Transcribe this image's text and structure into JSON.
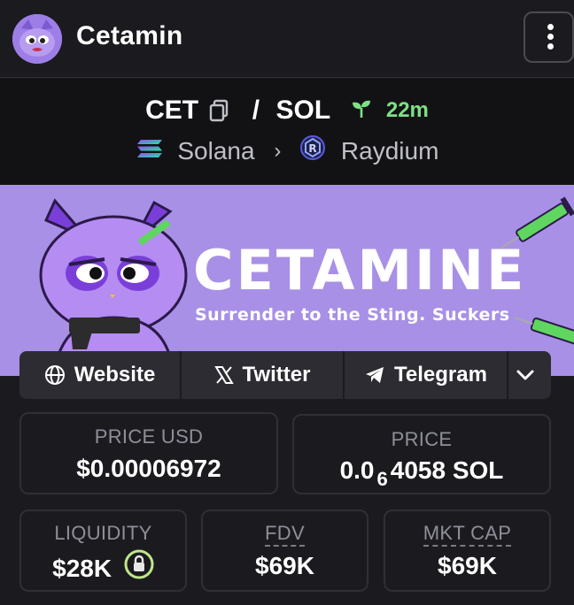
{
  "header": {
    "token_name": "Cetamin",
    "avatar_icon": "cat-face-avatar",
    "menu_icon": "vertical-dots-icon"
  },
  "pair": {
    "base": "CET",
    "separator": "/",
    "quote": "SOL",
    "age": "22m",
    "chain": "Solana",
    "dex": "Raydium",
    "accent_green": "#7de086"
  },
  "banner": {
    "title": "CETAMINE",
    "subtitle": "Surrender to the Sting. Suckers",
    "background": "#a890e6"
  },
  "links": {
    "website": "Website",
    "twitter": "Twitter",
    "telegram": "Telegram"
  },
  "stats": {
    "price_usd": {
      "label": "PRICE USD",
      "value": "$0.00006972"
    },
    "price": {
      "label": "PRICE",
      "prefix": "0.0",
      "zeros": "6",
      "suffix": "4058 SOL"
    },
    "liquidity": {
      "label": "LIQUIDITY",
      "value": "$28K"
    },
    "fdv": {
      "label": "FDV",
      "value": "$69K"
    },
    "mkt_cap": {
      "label": "MKT CAP",
      "value": "$69K"
    }
  }
}
